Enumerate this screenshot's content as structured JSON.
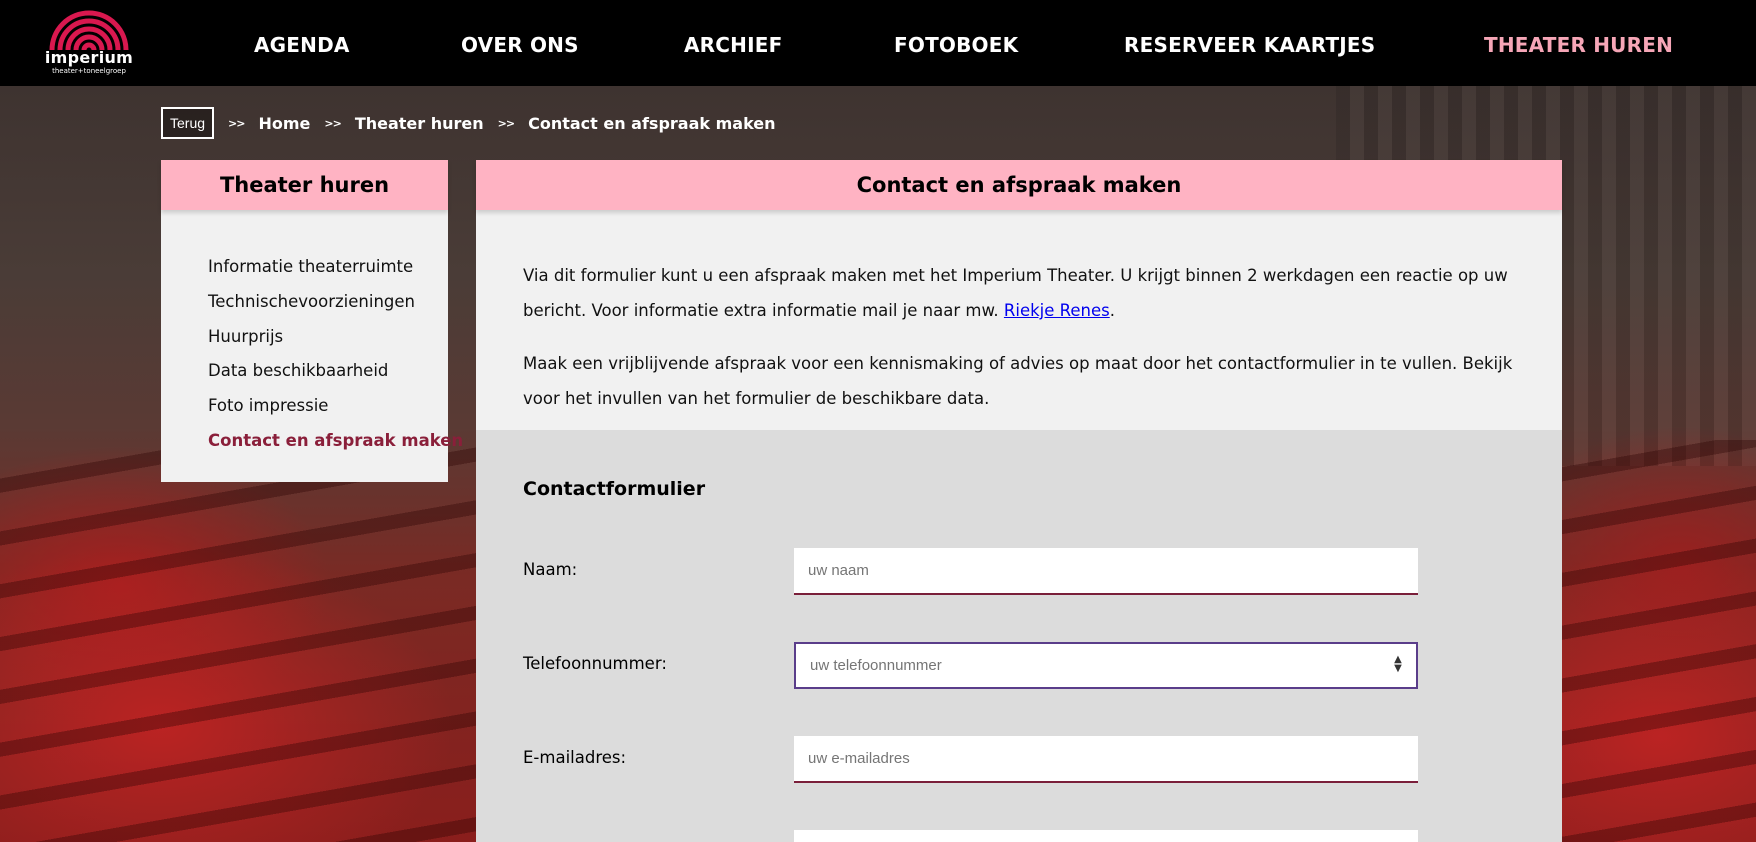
{
  "header": {
    "logo": {
      "brand": "imperium",
      "sub": "theater+toneelgroep",
      "accent_color": "#d9184f"
    },
    "nav": [
      {
        "label": "AGENDA"
      },
      {
        "label": "OVER ONS"
      },
      {
        "label": "ARCHIEF"
      },
      {
        "label": "FOTOBOEK"
      },
      {
        "label": "RESERVEER KAARTJES"
      },
      {
        "label": "THEATER HUREN",
        "active": true
      }
    ],
    "active_color": "#f6a6b7"
  },
  "breadcrumb": {
    "back_label": "Terug",
    "separator": ">>",
    "items": [
      "Home",
      "Theater huren",
      "Contact en afspraak maken"
    ]
  },
  "sidebar": {
    "title": "Theater huren",
    "items": [
      {
        "label": "Informatie theaterruimte"
      },
      {
        "label": "Technischevoorzieningen"
      },
      {
        "label": "Huurprijs"
      },
      {
        "label": "Data beschikbaarheid"
      },
      {
        "label": "Foto impressie"
      },
      {
        "label": "Contact en afspraak maken",
        "active": true
      }
    ]
  },
  "main": {
    "title": "Contact en afspraak maken",
    "intro_1_before_link": "Via dit formulier kunt u een afspraak maken met het Imperium Theater. U krijgt binnen 2 werkdagen een reactie op uw bericht. Voor informatie extra informatie mail je naar mw. ",
    "intro_1_link": "Riekje Renes",
    "intro_1_after_link": ".",
    "intro_2": "Maak een vrijblijvende afspraak voor een kennismaking of advies op maat door het contactformulier in te vullen. Bekijk voor het invullen van het formulier de beschikbare data."
  },
  "form": {
    "title": "Contactformulier",
    "fields": [
      {
        "label": "Naam:",
        "placeholder": "uw naam",
        "value": ""
      },
      {
        "label": "Telefoonnummer:",
        "placeholder": "uw telefoonnummer",
        "value": ""
      },
      {
        "label": "E-mailadres:",
        "placeholder": "uw e-mailadres",
        "value": ""
      }
    ]
  },
  "colors": {
    "panel_header": "#ffb3c3",
    "active_sidebar": "#8a1f3a",
    "input_underline": "#7a1f3a"
  }
}
